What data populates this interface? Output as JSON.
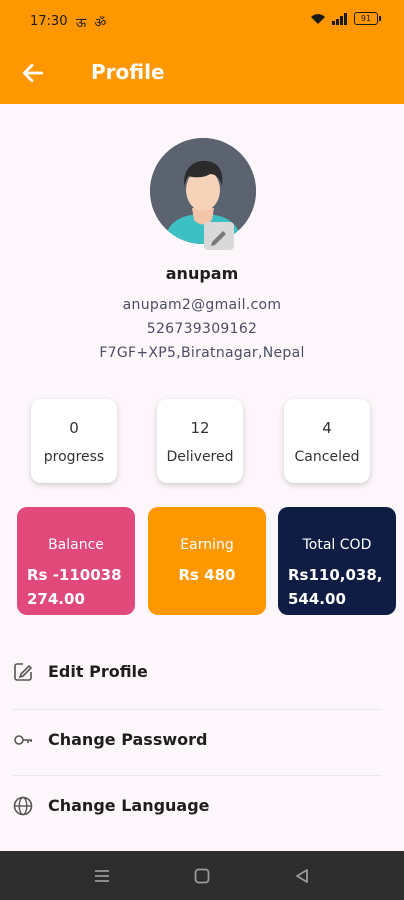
{
  "status_bar": {
    "time": "17:30",
    "notifications": "ऊ ॐ",
    "battery": "91",
    "icons": [
      "wifi-icon",
      "signal-icon",
      "battery-icon"
    ]
  },
  "app_bar": {
    "title": "Profile",
    "back_icon": "arrow-left-icon",
    "background": "#ff9800"
  },
  "profile": {
    "name": "anupam",
    "email": "anupam2@gmail.com",
    "phone": "526739309162",
    "address": "F7GF+XP5,Biratnagar,Nepal"
  },
  "stats": [
    {
      "value": "0",
      "label": "progress"
    },
    {
      "value": "12",
      "label": "Delivered"
    },
    {
      "value": "4",
      "label": "Canceled"
    }
  ],
  "cards": {
    "balance": {
      "title": "Balance",
      "value": "Rs -110038 274.00",
      "color": "#e0497a"
    },
    "earning": {
      "title": "Earning",
      "value": "Rs 480",
      "color": "#ff9800"
    },
    "total_cod": {
      "title": "Total COD",
      "value": "Rs110,038, 544.00",
      "color": "#0f1d45"
    }
  },
  "menu": [
    {
      "label": "Edit Profile",
      "icon": "edit-icon"
    },
    {
      "label": "Change Password",
      "icon": "key-icon"
    },
    {
      "label": "Change Language",
      "icon": "globe-icon"
    }
  ],
  "nav_bar": {
    "icons": [
      "menu-icon",
      "home-square-icon",
      "back-triangle-icon"
    ]
  }
}
